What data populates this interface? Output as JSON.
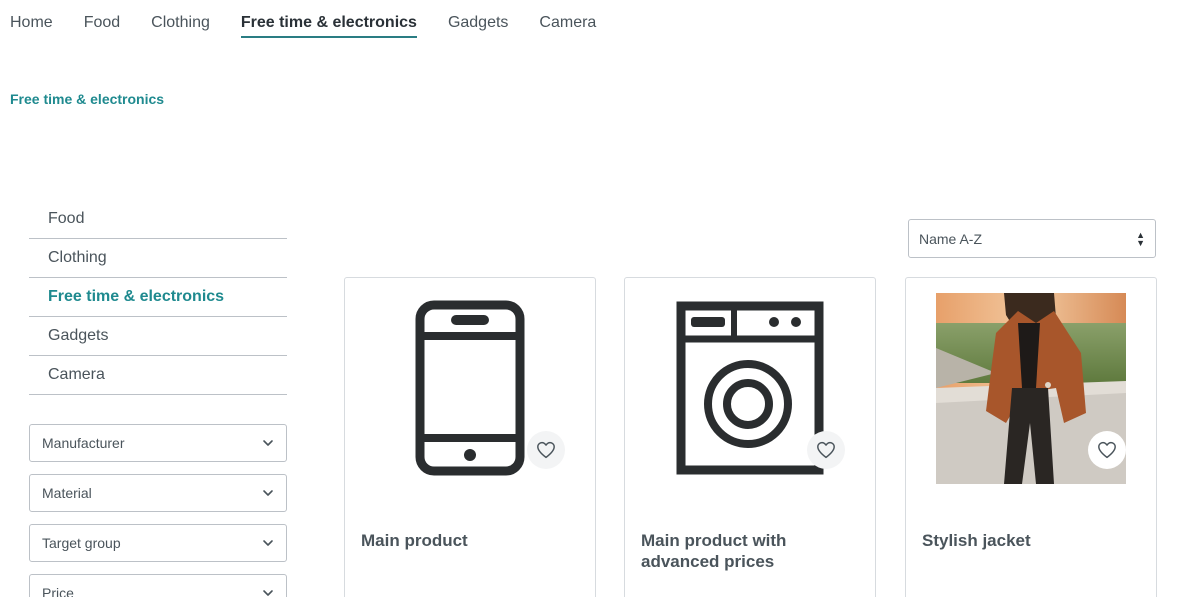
{
  "nav": {
    "items": [
      {
        "label": "Home"
      },
      {
        "label": "Food"
      },
      {
        "label": "Clothing"
      },
      {
        "label": "Free time & electronics",
        "active": true
      },
      {
        "label": "Gadgets"
      },
      {
        "label": "Camera"
      }
    ]
  },
  "breadcrumb": "Free time & electronics",
  "sidebar": {
    "categories": [
      {
        "label": "Food"
      },
      {
        "label": "Clothing"
      },
      {
        "label": "Free time & electronics",
        "active": true
      },
      {
        "label": "Gadgets"
      },
      {
        "label": "Camera"
      }
    ],
    "filters": [
      {
        "label": "Manufacturer"
      },
      {
        "label": "Material"
      },
      {
        "label": "Target group"
      },
      {
        "label": "Price"
      }
    ]
  },
  "sorting": {
    "selected": "Name A-Z"
  },
  "products": [
    {
      "title": "Main product",
      "image": "smartphone-icon"
    },
    {
      "title": "Main product with advanced prices",
      "image": "washing-machine-icon"
    },
    {
      "title": "Stylish jacket",
      "image": "jacket-photo"
    }
  ],
  "colors": {
    "accent": "#1f8a8f",
    "text": "#4a545b",
    "border": "#bcc1c7"
  }
}
